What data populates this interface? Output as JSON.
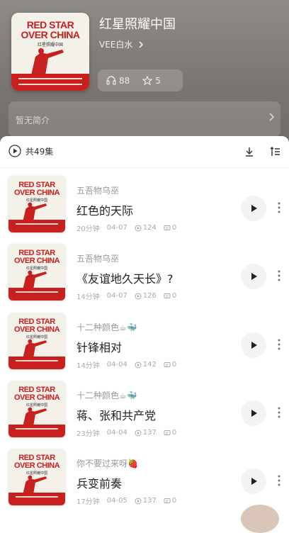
{
  "album": {
    "title": "红星照耀中国",
    "author": "VEE白水",
    "listens": "88",
    "favorites": "5",
    "intro": "暂无简介",
    "cover": {
      "line1": "RED STAR",
      "line2": "OVER CHINA",
      "subtitle": "红星照耀中国"
    }
  },
  "list": {
    "count_label": "共49集"
  },
  "episodes": [
    {
      "by": "五吾物乌巫",
      "title": "红色的天际",
      "duration": "20分钟",
      "date": "04-07",
      "plays": "124",
      "comments": "0"
    },
    {
      "by": "五吾物乌巫",
      "title": "《友谊地久天长》?",
      "duration": "14分钟",
      "date": "04-07",
      "plays": "126",
      "comments": "0"
    },
    {
      "by": "十二种颜色☕🐳",
      "title": "针锋相对",
      "duration": "14分钟",
      "date": "04-04",
      "plays": "142",
      "comments": "0"
    },
    {
      "by": "十二种颜色☕🐳",
      "title": "蒋、张和共产党",
      "duration": "23分钟",
      "date": "04-04",
      "plays": "137",
      "comments": "0"
    },
    {
      "by": "你不要过来呀🍓",
      "title": "兵变前奏",
      "duration": "17分钟",
      "date": "04-05",
      "plays": "137",
      "comments": "0"
    }
  ],
  "icons": {
    "listen": "headphones-icon",
    "favorite": "star-icon",
    "play_all": "play-circle-icon",
    "download": "download-icon",
    "sort": "sort-icon",
    "play": "play-icon",
    "more": "more-vertical-icon"
  },
  "colors": {
    "accent": "#c8201e",
    "hero": "#7a7672"
  }
}
